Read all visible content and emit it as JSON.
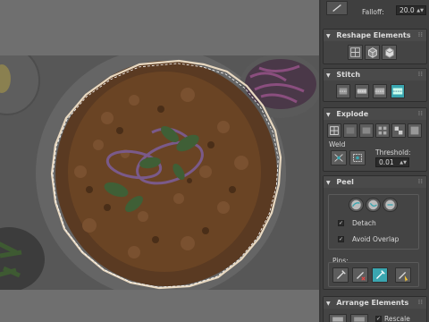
{
  "falloff": {
    "label": "Falloff:",
    "value": "20.0"
  },
  "rollouts": {
    "reshape": {
      "title": "Reshape Elements"
    },
    "stitch": {
      "title": "Stitch"
    },
    "explode": {
      "title": "Explode",
      "weld_label": "Weld",
      "threshold_label": "Threshold:",
      "threshold_value": "0.01"
    },
    "peel": {
      "title": "Peel",
      "detach_label": "Detach",
      "avoid_overlap_label": "Avoid Overlap",
      "pins_label": "Pins:"
    },
    "arrange": {
      "title": "Arrange Elements",
      "rescale_label": "Rescale"
    }
  },
  "colors": {
    "accent": "#3aa6b0",
    "panel_bg": "#3f3f3f",
    "rollout_bg": "#444444"
  }
}
